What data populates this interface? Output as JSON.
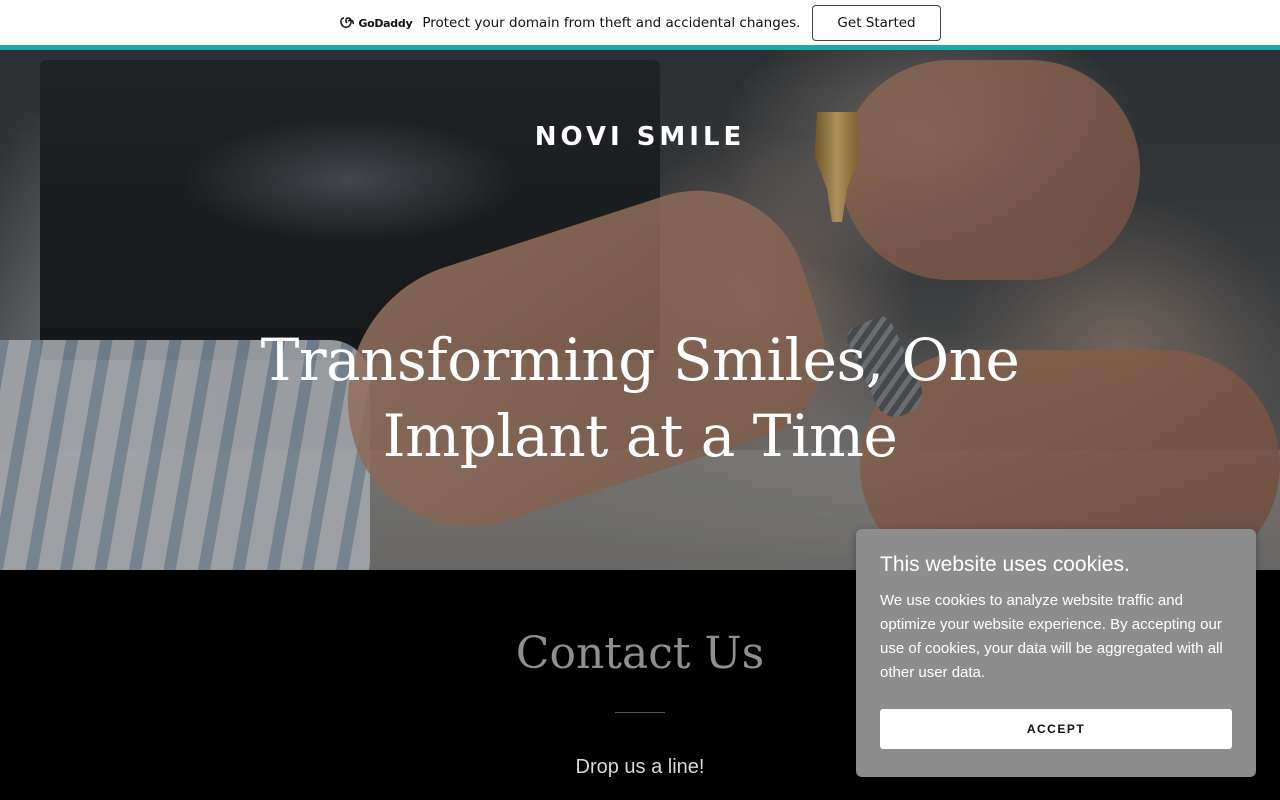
{
  "promo": {
    "brand": "GoDaddy",
    "brand_icon": "godaddy-logo-icon",
    "message": "Protect your domain from theft and accidental changes.",
    "cta_label": "Get Started",
    "accent_color": "#1ba8a9"
  },
  "hero": {
    "site_title": "NOVI SMILE",
    "heading": "Transforming Smiles, One Implant at a Time"
  },
  "contact": {
    "heading": "Contact Us",
    "subheading": "Drop us a line!"
  },
  "cookie_banner": {
    "title": "This website uses cookies.",
    "body": "We use cookies to analyze website traffic and optimize your website experience. By accepting our use of cookies, your data will be aggregated with all other user data.",
    "accept_label": "ACCEPT",
    "background_color": "#8d8d8d"
  }
}
